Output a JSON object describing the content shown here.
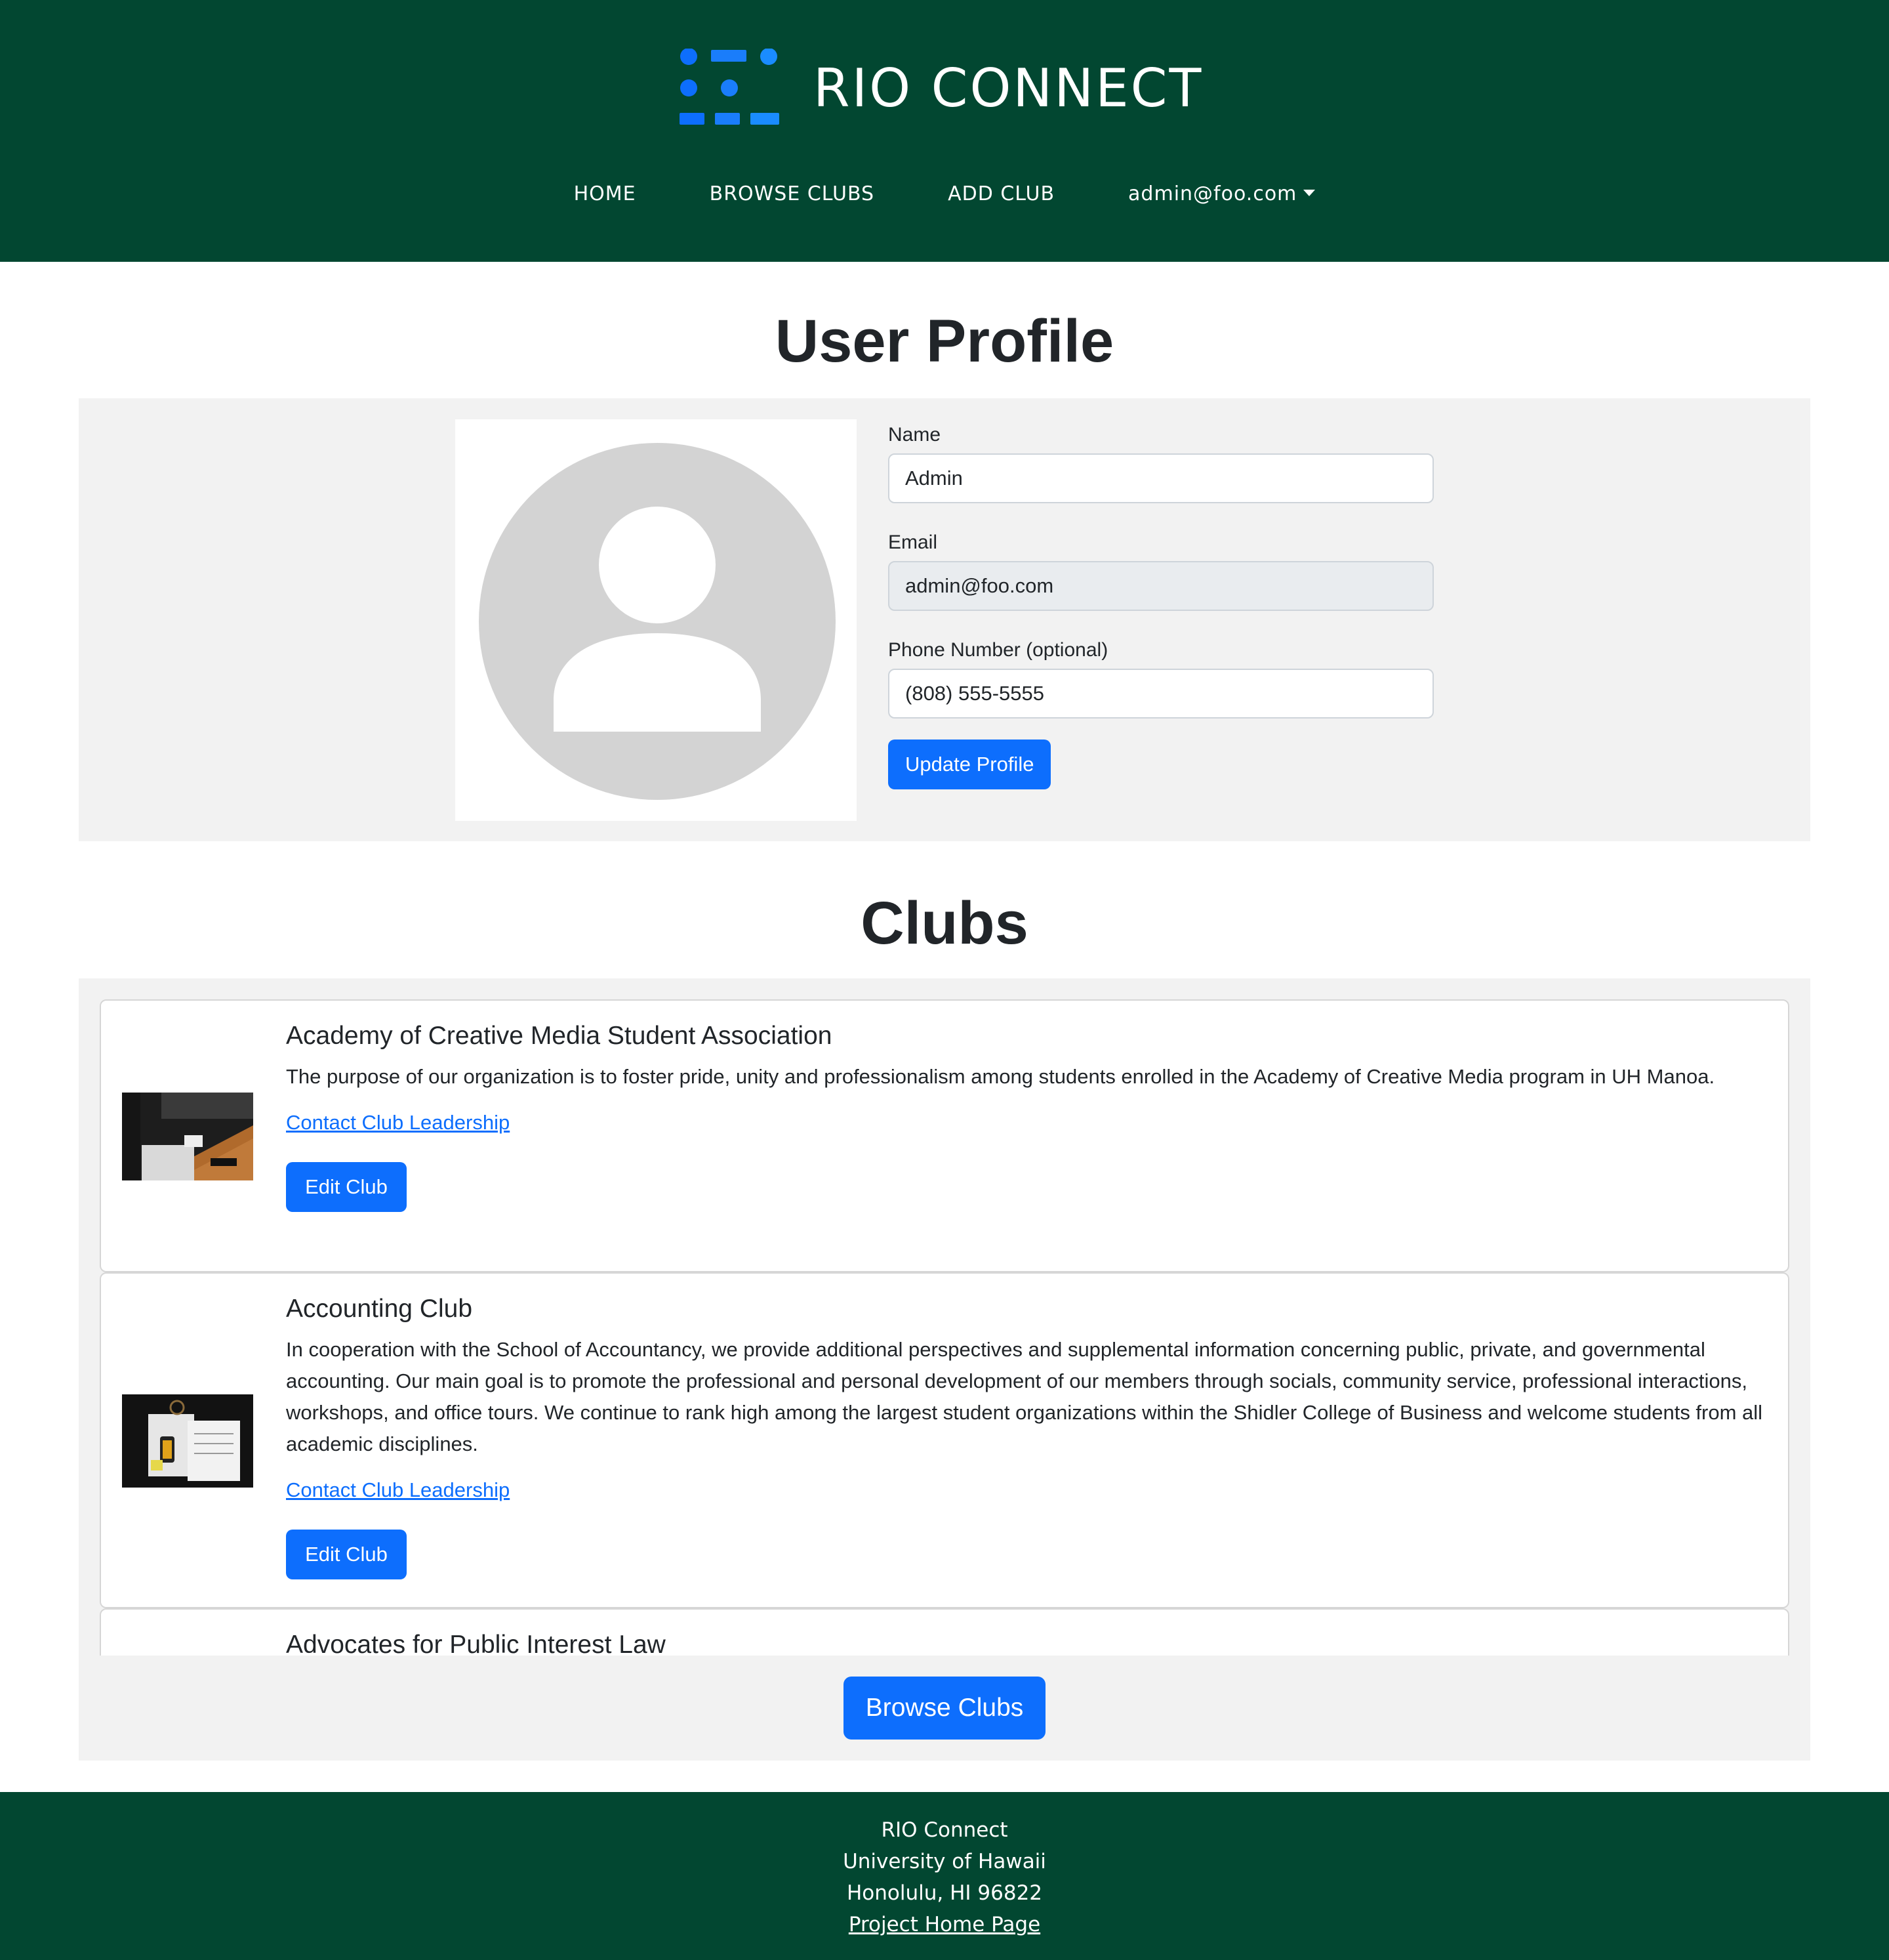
{
  "header": {
    "brand_title": "RIO CONNECT",
    "logo_icon": "rio-connect-logo",
    "nav": {
      "home": "HOME",
      "browse_clubs": "BROWSE CLUBS",
      "add_club": "ADD CLUB",
      "user_menu": "admin@foo.com"
    },
    "colors": {
      "background": "#024731",
      "logo_blue": "#0d6efd"
    }
  },
  "profile": {
    "heading": "User Profile",
    "avatar_icon": "user-avatar-icon",
    "name_label": "Name",
    "name_value": "Admin",
    "email_label": "Email",
    "email_value": "admin@foo.com",
    "phone_label": "Phone Number (optional)",
    "phone_value": "(808) 555-5555",
    "update_button": "Update Profile"
  },
  "clubs": {
    "heading": "Clubs",
    "items": [
      {
        "title": "Academy of Creative Media Student Association",
        "description": "The purpose of our organization is to foster pride, unity and professionalism among students enrolled in the Academy of Creative Media program in UH Manoa.",
        "contact_link": "Contact Club Leadership",
        "edit_button": "Edit Club"
      },
      {
        "title": "Accounting Club",
        "description": "In cooperation with the School of Accountancy, we provide additional perspectives and supplemental information concerning public, private, and governmental accounting. Our main goal is to promote the professional and personal development of our members through socials, community service, professional interactions, workshops, and office tours. We continue to rank high among the largest student organizations within the Shidler College of Business and welcome students from all academic disciplines.",
        "contact_link": "Contact Club Leadership",
        "edit_button": "Edit Club"
      },
      {
        "title": "Advocates for Public Interest Law"
      }
    ],
    "browse_button": "Browse Clubs"
  },
  "footer": {
    "line1": "RIO Connect",
    "line2": "University of Hawaii",
    "line3": "Honolulu, HI 96822",
    "link": "Project Home Page"
  },
  "accent_color": "#0d6efd"
}
